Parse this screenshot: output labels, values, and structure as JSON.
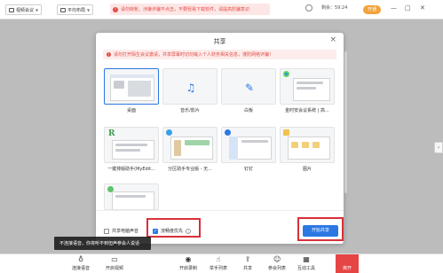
{
  "topbar": {
    "video_meeting": "视频会议",
    "layout": "平均布局",
    "notice_text": "请勿转账，涉嫌诈骗不点击，不要轻易下载软件，请提高防骗意识",
    "timer": "剩余：59:24",
    "vip_label": "开通"
  },
  "dialog": {
    "title": "共享",
    "warning": "请勿打开陌生会议邀请，共享屏幕时切勿输入个人财务相关信息，谨防网络诈骗！",
    "tiles": [
      {
        "label": "桌面",
        "icon": "desktop-thumbnail"
      },
      {
        "label": "音乐/影片",
        "icon": "music-note-icon"
      },
      {
        "label": "白板",
        "icon": "pen-icon"
      },
      {
        "label": "金时安会议系统 | 高...",
        "icon": "edge-browser-icon"
      },
      {
        "label": "一键排版助手(MyEdit...",
        "icon": "app-logo-icon"
      },
      {
        "label": "分区助手专业版 - 无...",
        "icon": "partition-app-icon"
      },
      {
        "label": "钉钉",
        "icon": "dingtalk-icon"
      },
      {
        "label": "图片",
        "icon": "folder-icon"
      },
      {
        "label": "",
        "icon": "window-thumbnail"
      }
    ],
    "share_audio_label": "共享电脑声音",
    "smooth_priority_label": "流畅度优先",
    "start_share_label": "开始共享"
  },
  "side_button_icon": "chevron-left-icon",
  "toast": "不连接语音，你将听不到但声参会人说话",
  "bottombar": {
    "items": [
      {
        "label": "连接语音",
        "icon": "headset-icon"
      },
      {
        "label": "开启视频",
        "icon": "camera-icon"
      },
      {
        "label": "开启录制",
        "icon": "record-icon"
      },
      {
        "label": "举手列表",
        "icon": "hand-icon"
      },
      {
        "label": "共享",
        "icon": "share-icon"
      },
      {
        "label": "参会列表",
        "icon": "participants-icon"
      },
      {
        "label": "互动工具",
        "icon": "interactive-tools-icon"
      }
    ],
    "end_label": "离开"
  },
  "colors": {
    "accent": "#2b78e4",
    "danger": "#d8303a",
    "warning_bg": "#fdeceb",
    "vip": "#f2a33a"
  }
}
